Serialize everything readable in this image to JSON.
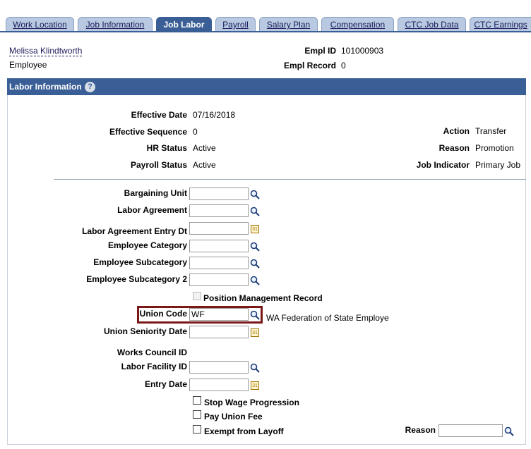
{
  "tabs": [
    {
      "label": "Work Location",
      "active": false
    },
    {
      "label": "Job Information",
      "active": false
    },
    {
      "label": "Job Labor",
      "active": true
    },
    {
      "label": "Payroll",
      "active": false
    },
    {
      "label": "Salary Plan",
      "active": false
    },
    {
      "label": "Compensation",
      "active": false
    },
    {
      "label": "CTC Job Data",
      "active": false
    },
    {
      "label": "CTC Earnings",
      "active": false
    }
  ],
  "header": {
    "employee_name": "Melissa Klindtworth",
    "employee_type": "Employee",
    "empl_id_label": "Empl ID",
    "empl_id": "101000903",
    "empl_record_label": "Empl Record",
    "empl_record": "0"
  },
  "section": {
    "title": "Labor Information",
    "help_glyph": "?"
  },
  "summary": {
    "effective_date_label": "Effective Date",
    "effective_date": "07/16/2018",
    "effective_sequence_label": "Effective Sequence",
    "effective_sequence": "0",
    "hr_status_label": "HR Status",
    "hr_status": "Active",
    "payroll_status_label": "Payroll Status",
    "payroll_status": "Active",
    "action_label": "Action",
    "action": "Transfer",
    "reason_label": "Reason",
    "reason": "Promotion",
    "job_indicator_label": "Job Indicator",
    "job_indicator": "Primary Job"
  },
  "fields": {
    "bargaining_unit_label": "Bargaining Unit",
    "bargaining_unit": "",
    "labor_agreement_label": "Labor Agreement",
    "labor_agreement": "",
    "labor_agreement_entry_dt_label": "Labor Agreement Entry Dt",
    "labor_agreement_entry_dt": "",
    "employee_category_label": "Employee Category",
    "employee_category": "",
    "employee_subcategory_label": "Employee Subcategory",
    "employee_subcategory": "",
    "employee_subcategory2_label": "Employee Subcategory 2",
    "employee_subcategory2": "",
    "position_mgmt_label": "Position Management Record",
    "union_code_label": "Union Code",
    "union_code": "WF",
    "union_code_desc": "WA Federation of State Employe",
    "union_seniority_label": "Union Seniority Date",
    "union_seniority": "",
    "works_council_label": "Works Council ID",
    "labor_facility_label": "Labor Facility ID",
    "labor_facility": "",
    "entry_date_label": "Entry Date",
    "entry_date": "",
    "stop_wage_label": "Stop Wage Progression",
    "pay_union_fee_label": "Pay Union Fee",
    "exempt_layoff_label": "Exempt from Layoff",
    "layoff_reason_label": "Reason",
    "layoff_reason": ""
  },
  "icons": {
    "lookup": "magnifier-icon",
    "calendar": "calendar-icon",
    "calendar_glyph": "31"
  },
  "colors": {
    "accent": "#3a5e96",
    "tab_inactive": "#b8c9e1",
    "highlight": "#7a1818"
  }
}
